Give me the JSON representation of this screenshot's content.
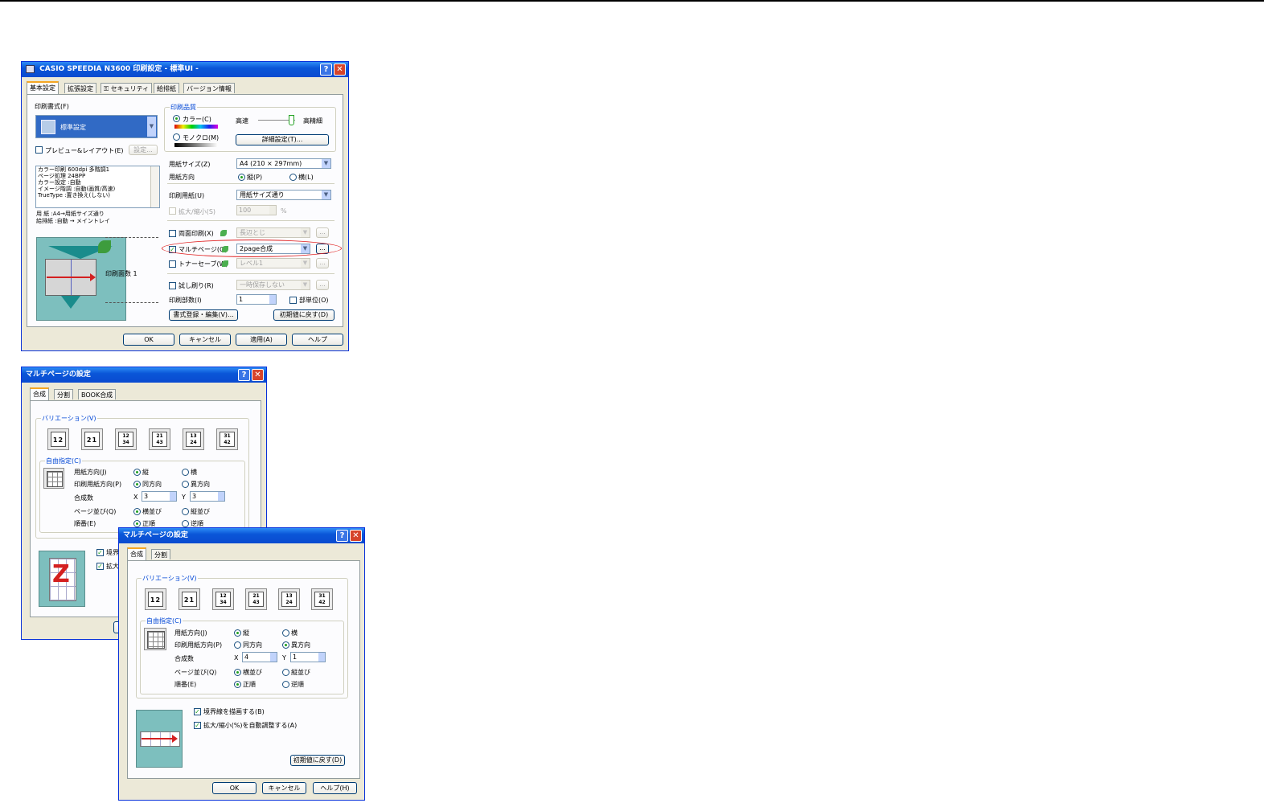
{
  "win1": {
    "title": "CASIO SPEEDIA N3600 印刷設定 - 標準UI -",
    "tabs": [
      "基本設定",
      "拡張設定",
      "セキュリティ",
      "給排紙",
      "バージョン情報"
    ],
    "print_format_label": "印刷書式(F)",
    "print_format_value": "標準設定",
    "preview_layout": "プレビュー&レイアウト(E)",
    "setting_btn": "設定...",
    "info_lines": [
      "カラー印刷   600dpi  多階調1",
      "ページ処理   24BPP",
      "カラー設定   :自動",
      "イメージ階調 :自動(画質/高速)",
      "TrueType    :置き換え(しない)"
    ],
    "paper_lines": [
      "用 紙 :A4→用紙サイズ通り",
      "給排紙 :自動 → メイントレイ"
    ],
    "print_pages_label": "印刷面数 1",
    "quality_group": "印刷品質",
    "color": "カラー(C)",
    "mono": "モノクロ(M)",
    "speed": "高速",
    "fine": "高精細",
    "detail_btn": "詳細設定(T)...",
    "paper_size_label": "用紙サイズ(Z)",
    "paper_size_value": "A4 (210 × 297mm)",
    "orientation_label": "用紙方向",
    "portrait": "縦(P)",
    "landscape": "横(L)",
    "print_paper_label": "印刷用紙(U)",
    "print_paper_value": "用紙サイズ通り",
    "zoom_label": "拡大/縮小(S)",
    "zoom_value": "100",
    "percent": "%",
    "duplex_label": "両面印刷(X)",
    "duplex_value": "長辺とじ",
    "multipage_label": "マルチページ(Q)",
    "multipage_value": "2page合成",
    "toner_label": "トナーセーブ(W)",
    "toner_value": "レベル1",
    "trial_label": "試し刷り(R)",
    "trial_value": "一時保存しない",
    "copies_label": "印刷部数(I)",
    "copies_value": "1",
    "collate": "部単位(O)",
    "format_btn": "書式登録・編集(V)...",
    "default_btn": "初期値に戻す(D)",
    "dots": "...",
    "ok": "OK",
    "cancel": "キャンセル",
    "apply": "適用(A)",
    "help": "ヘルプ"
  },
  "win2": {
    "title": "マルチページの設定",
    "tabs": [
      "合成",
      "分割",
      "BOOK合成"
    ],
    "variation": "バリエーション(V)",
    "free": "自由指定(C)",
    "paper_dir": "用紙方向(J)",
    "tate": "縦",
    "yoko": "横",
    "print_dir": "印刷用紙方向(P)",
    "same": "同方向",
    "diff": "異方向",
    "count": "合成数",
    "x_label": "X",
    "x_value": "3",
    "y_label": "Y",
    "y_value": "3",
    "order_label": "ページ並び(Q)",
    "horizontal": "横並び",
    "vertical": "縦並び",
    "seq_label": "順番(E)",
    "forward": "正順",
    "reverse": "逆順",
    "border_partial": "境界",
    "zoom_partial": "拡大"
  },
  "win3": {
    "title": "マルチページの設定",
    "tabs": [
      "合成",
      "分割"
    ],
    "variation": "バリエーション(V)",
    "free": "自由指定(C)",
    "paper_dir": "用紙方向(J)",
    "tate": "縦",
    "yoko": "横",
    "print_dir": "印刷用紙方向(P)",
    "same": "同方向",
    "diff": "異方向",
    "count": "合成数",
    "x_label": "X",
    "x_value": "4",
    "y_label": "Y",
    "y_value": "1",
    "order_label": "ページ並び(Q)",
    "horizontal": "横並び",
    "vertical": "縦並び",
    "seq_label": "順番(E)",
    "forward": "正順",
    "reverse": "逆順",
    "border": "境界線を描画する(B)",
    "auto_zoom": "拡大/縮小(%)を自動調整する(A)",
    "default_btn": "初期値に戻す(D)",
    "ok": "OK",
    "cancel": "キャンセル",
    "help": "ヘルプ(H)"
  },
  "variations": [
    "12",
    "21",
    "12/34",
    "21/43",
    "13/24",
    "31/42"
  ],
  "colors": {
    "titlebar": "#0a56d8",
    "dialog_bg": "#ece9d8",
    "highlight_oval": "#e02020",
    "preview_teal": "#7dbfbe",
    "arrow_red": "#d42020"
  }
}
